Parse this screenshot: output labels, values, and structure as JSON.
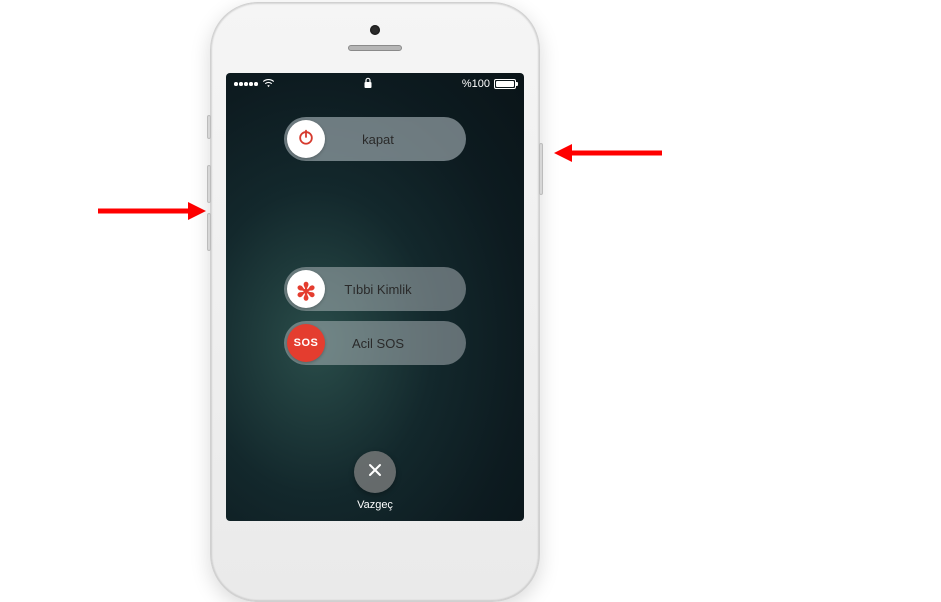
{
  "statusbar": {
    "battery_text": "%100"
  },
  "sliders": {
    "poweroff_label": "kapat",
    "medical_label": "Tıbbi Kimlik",
    "sos_text": "SOS",
    "sos_label": "Acil SOS"
  },
  "cancel": {
    "label": "Vazgeç"
  },
  "colors": {
    "accent_red": "#e43d2f",
    "arrow_red": "#ff0000"
  }
}
